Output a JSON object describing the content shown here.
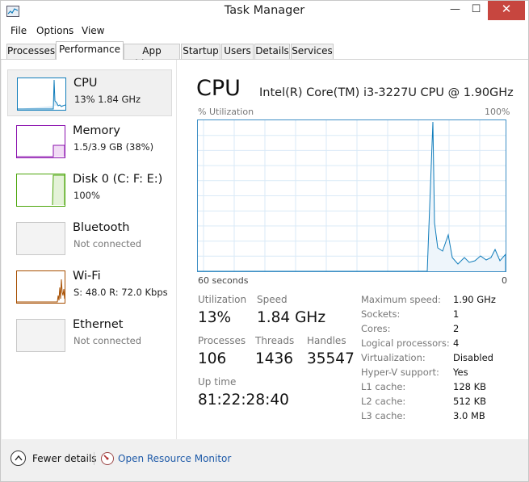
{
  "window": {
    "title": "Task Manager",
    "controls": {
      "minimize": "—",
      "maximize": "☐",
      "close": "✕"
    }
  },
  "menu": [
    "File",
    "Options",
    "View"
  ],
  "tabs": [
    "Processes",
    "Performance",
    "App history",
    "Startup",
    "Users",
    "Details",
    "Services"
  ],
  "active_tab": "Performance",
  "sidebar": [
    {
      "name": "CPU",
      "detail": "13%  1.84 GHz",
      "color": "#117dbb",
      "selected": true
    },
    {
      "name": "Memory",
      "detail": "1.5/3.9 GB (38%)",
      "color": "#8b12ae",
      "selected": false
    },
    {
      "name": "Disk 0 (C: F: E:)",
      "detail": "100%",
      "color": "#4da60c",
      "selected": false
    },
    {
      "name": "Bluetooth",
      "detail": "Not connected",
      "color": "#c8c8c8",
      "selected": false
    },
    {
      "name": "Wi-Fi",
      "detail": "S: 48.0  R: 72.0 Kbps",
      "color": "#a74f01",
      "selected": false
    },
    {
      "name": "Ethernet",
      "detail": "Not connected",
      "color": "#c8c8c8",
      "selected": false
    }
  ],
  "main": {
    "title": "CPU",
    "cpu_model": "Intel(R) Core(TM) i3-3227U CPU @ 1.90GHz",
    "graph": {
      "y_label": "% Utilization",
      "y_max_label": "100%",
      "x_left_label": "60 seconds",
      "x_right_label": "0",
      "line_color": "#117dbb"
    },
    "stats": {
      "utilization": {
        "label": "Utilization",
        "value": "13%"
      },
      "speed": {
        "label": "Speed",
        "value": "1.84 GHz"
      },
      "processes": {
        "label": "Processes",
        "value": "106"
      },
      "threads": {
        "label": "Threads",
        "value": "1436"
      },
      "handles": {
        "label": "Handles",
        "value": "35547"
      },
      "uptime": {
        "label": "Up time",
        "value": "81:22:28:40"
      }
    },
    "properties": [
      {
        "label": "Maximum speed:",
        "value": "1.90 GHz"
      },
      {
        "label": "Sockets:",
        "value": "1"
      },
      {
        "label": "Cores:",
        "value": "2"
      },
      {
        "label": "Logical processors:",
        "value": "4"
      },
      {
        "label": "Virtualization:",
        "value": "Disabled"
      },
      {
        "label": "Hyper-V support:",
        "value": "Yes"
      },
      {
        "label": "L1 cache:",
        "value": "128 KB"
      },
      {
        "label": "L2 cache:",
        "value": "512 KB"
      },
      {
        "label": "L3 cache:",
        "value": "3.0 MB"
      }
    ]
  },
  "footer": {
    "fewer_details": "Fewer details",
    "open_resource_monitor": "Open Resource Monitor"
  }
}
